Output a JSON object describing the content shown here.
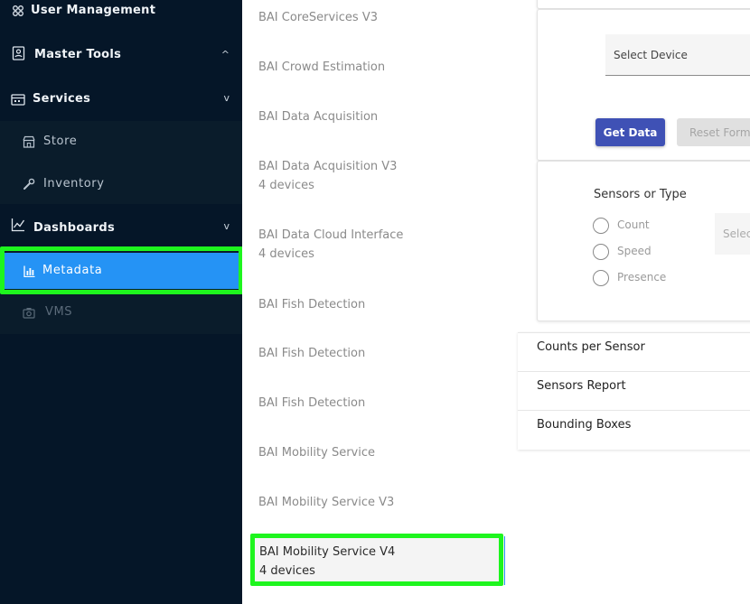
{
  "sidebar": {
    "user_management": "User Management",
    "master_tools": "Master Tools",
    "master_tools_chevron": "^",
    "services": "Services",
    "services_chevron": "v",
    "store": "Store",
    "inventory": "Inventory",
    "dashboards": "Dashboards",
    "dashboards_chevron": "v",
    "metadata": "Metadata",
    "vms": "VMS",
    "colors": {
      "bg": "#051628",
      "active": "#2593f5",
      "highlight": "#1ef51e"
    }
  },
  "service_list": [
    {
      "name": "BAI CoreServices V3",
      "devices": ""
    },
    {
      "name": "BAI Crowd Estimation",
      "devices": ""
    },
    {
      "name": "BAI Data Acquisition",
      "devices": ""
    },
    {
      "name": "BAI Data Acquisition V3",
      "devices": "4 devices"
    },
    {
      "name": "BAI Data Cloud Interface",
      "devices": "4 devices"
    },
    {
      "name": "BAI Fish Detection",
      "devices": ""
    },
    {
      "name": "BAI Fish Detection",
      "devices": ""
    },
    {
      "name": "BAI Fish Detection",
      "devices": ""
    },
    {
      "name": "BAI Mobility Service",
      "devices": ""
    },
    {
      "name": "BAI Mobility Service V3",
      "devices": ""
    },
    {
      "name": "BAI Mobility Service V4",
      "devices": "4 devices"
    }
  ],
  "form": {
    "select_device_placeholder": "Select Device",
    "get_data": "Get Data",
    "reset_form": "Reset Form",
    "sensors_title": "Sensors or Type",
    "radio_options": [
      "Count",
      "Speed",
      "Presence"
    ],
    "select_small_placeholder": "Select"
  },
  "accordion": [
    "Counts per Sensor",
    "Sensors Report",
    "Bounding Boxes"
  ]
}
